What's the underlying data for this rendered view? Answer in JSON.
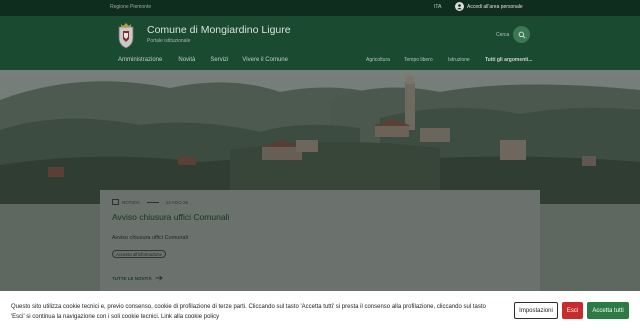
{
  "topbar": {
    "region": "Regione Piemonte",
    "language": "ITA",
    "login_label": "Accedi all'area personale"
  },
  "header": {
    "title": "Comune di Mongiardino Ligure",
    "subtitle": "Portale istituzionale",
    "search_label": "Cerca"
  },
  "nav": {
    "main": [
      "Amministrazione",
      "Novità",
      "Servizi",
      "Vivere il Comune"
    ],
    "secondary": [
      "Agricoltura",
      "Tempo libero",
      "Istruzione"
    ],
    "all_topics": "Tutti gli argomenti..."
  },
  "news_card": {
    "category": "NOTIZIA",
    "date": "13 AGO 25",
    "headline": "Avviso chiusura uffici Comunali",
    "body": "Avviso chiusura uffici Comunali",
    "tag": "Accesso all'informazione",
    "all_news": "TUTTE LE NOVITÀ"
  },
  "cookie_banner": {
    "text": "Questo sito utilizza cookie tecnici e, previo consenso, cookie di profilazione di terze parti. Cliccando sul tasto 'Accetta tutti' si presta il consenso alla profilazione, cliccando sul tasto 'Esci' si continua la navigazione con i soli cookie tecnici. Link alla cookie policy",
    "settings": "Impostazioni",
    "exit": "Esci",
    "accept": "Accetta tutti"
  },
  "colors": {
    "header_bg": "#1a4a30",
    "topbar_bg": "#0f2d1e",
    "accept_button": "#2c7a46",
    "exit_button": "#c72b2b"
  }
}
